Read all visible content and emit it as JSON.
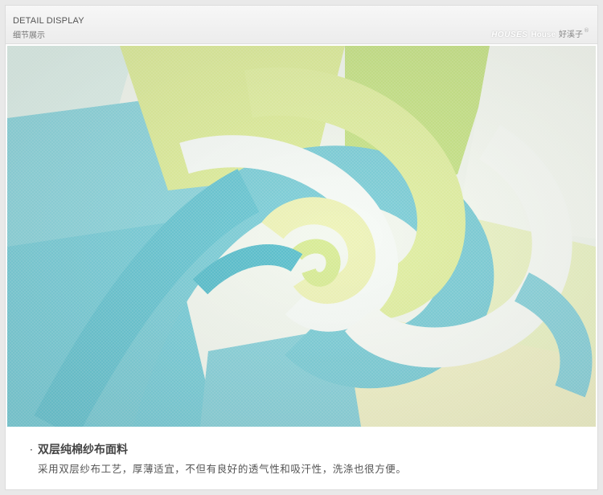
{
  "header": {
    "title_en": "DETAIL DISPLAY",
    "title_cn": "细节展示",
    "brand_logo": "HOUSES",
    "brand_house": "House",
    "brand_cn": "好溪子",
    "brand_reg": "®"
  },
  "photo": {
    "icon": "fabric-swirl-photo",
    "colors": {
      "cyan": "#7ccfd9",
      "lime": "#d9ec8e",
      "pale_yellow": "#f2f3c3",
      "white": "#f6fbf8"
    }
  },
  "caption": {
    "bullet": "·",
    "title": "双层纯棉纱布面料",
    "text": "采用双层纱布工艺，厚薄适宜，不但有良好的透气性和吸汗性，洗涤也很方便。"
  }
}
